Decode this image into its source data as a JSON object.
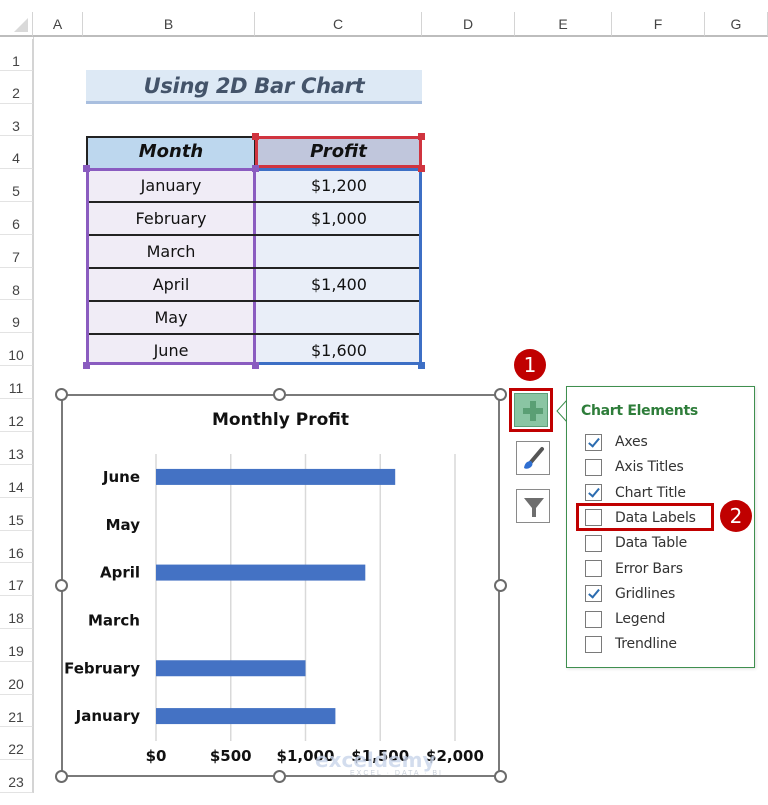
{
  "sheet": {
    "columns": [
      "A",
      "B",
      "C",
      "D",
      "E",
      "F",
      "G"
    ],
    "rows": [
      "1",
      "2",
      "3",
      "4",
      "5",
      "6",
      "7",
      "8",
      "9",
      "10",
      "11",
      "12",
      "13",
      "14",
      "15",
      "16",
      "17",
      "18",
      "19",
      "20",
      "21",
      "22",
      "23"
    ]
  },
  "title_cell": "Using 2D Bar Chart",
  "table": {
    "headers": [
      "Month",
      "Profit"
    ],
    "rows": [
      {
        "month": "January",
        "profit": "$1,200"
      },
      {
        "month": "February",
        "profit": "$1,000"
      },
      {
        "month": "March",
        "profit": ""
      },
      {
        "month": "April",
        "profit": "$1,400"
      },
      {
        "month": "May",
        "profit": ""
      },
      {
        "month": "June",
        "profit": "$1,600"
      }
    ]
  },
  "chart_data": {
    "type": "bar",
    "orientation": "horizontal",
    "title": "Monthly Profit",
    "categories": [
      "January",
      "February",
      "March",
      "April",
      "May",
      "June"
    ],
    "values": [
      1200,
      1000,
      null,
      1400,
      null,
      1600
    ],
    "xlabel": "",
    "ylabel": "",
    "xlim": [
      0,
      2000
    ],
    "xticks": [
      0,
      500,
      1000,
      1500,
      2000
    ],
    "xtick_labels": [
      "$0",
      "$500",
      "$1,000",
      "$1,500",
      "$2,000"
    ],
    "grid": true,
    "legend": "none",
    "bar_color": "#4472c4"
  },
  "chart_buttons": {
    "add_element": "plus-icon",
    "styles": "paintbrush-icon",
    "filters": "filter-icon"
  },
  "chart_elements_panel": {
    "title": "Chart Elements",
    "options": [
      {
        "label": "Axes",
        "checked": true
      },
      {
        "label": "Axis Titles",
        "checked": false
      },
      {
        "label": "Chart Title",
        "checked": true
      },
      {
        "label": "Data Labels",
        "checked": false
      },
      {
        "label": "Data Table",
        "checked": false
      },
      {
        "label": "Error Bars",
        "checked": false
      },
      {
        "label": "Gridlines",
        "checked": true
      },
      {
        "label": "Legend",
        "checked": false
      },
      {
        "label": "Trendline",
        "checked": false
      }
    ]
  },
  "annotations": {
    "step1": "1",
    "step2": "2"
  },
  "watermark": {
    "brand": "exceldemy",
    "tagline": "EXCEL · DATA · BI"
  },
  "colors": {
    "accent_red": "#c00000",
    "panel_green": "#2e7d3a",
    "bar_blue": "#4472c4"
  }
}
